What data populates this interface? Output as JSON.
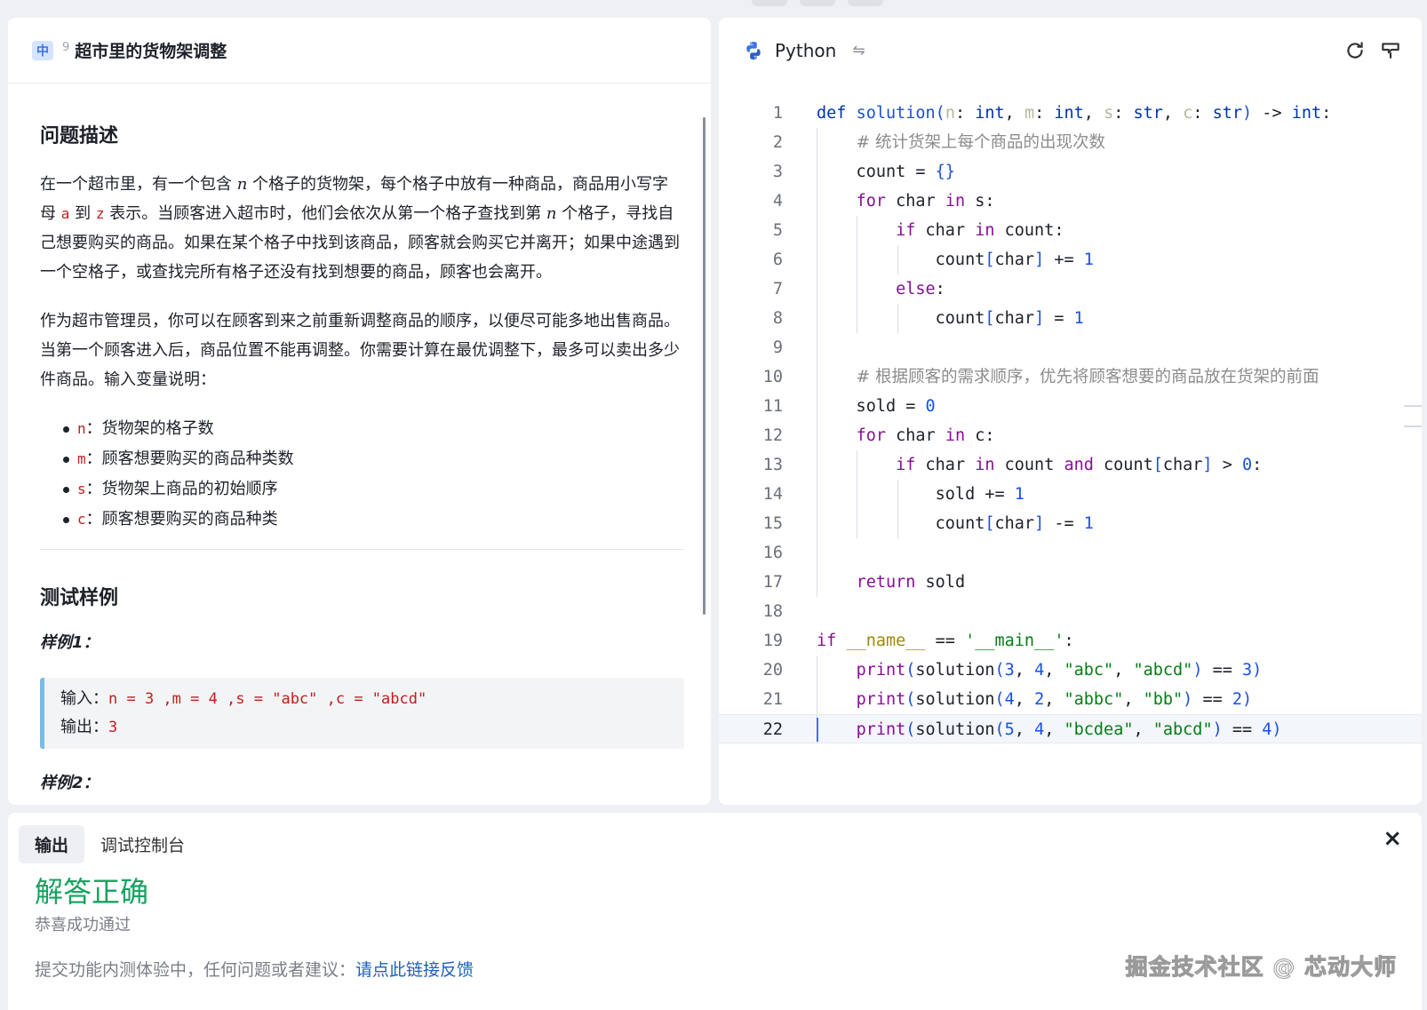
{
  "problem": {
    "difficulty": "中",
    "number": "9",
    "title": "超市里的货物架调整",
    "description_heading": "问题描述",
    "p1": [
      {
        "t": "text",
        "v": "在一个超市里，有一个包含 "
      },
      {
        "t": "var",
        "v": "n"
      },
      {
        "t": "text",
        "v": " 个格子的货物架，每个格子中放有一种商品，商品用小写字母 "
      },
      {
        "t": "code",
        "v": "a"
      },
      {
        "t": "text",
        "v": " 到 "
      },
      {
        "t": "code",
        "v": "z"
      },
      {
        "t": "text",
        "v": " 表示。当顾客进入超市时，他们会依次从第一个格子查找到第 "
      },
      {
        "t": "var",
        "v": "n"
      },
      {
        "t": "text",
        "v": " 个格子，寻找自己想要购买的商品。如果在某个格子中找到该商品，顾客就会购买它并离开；如果中途遇到一个空格子，或查找完所有格子还没有找到想要的商品，顾客也会离开。"
      }
    ],
    "p2": "作为超市管理员，你可以在顾客到来之前重新调整商品的顺序，以便尽可能多地出售商品。当第一个顾客进入后，商品位置不能再调整。你需要计算在最优调整下，最多可以卖出多少件商品。输入变量说明：",
    "vars": [
      {
        "name": "n",
        "desc": "：货物架的格子数"
      },
      {
        "name": "m",
        "desc": "：顾客想要购买的商品种类数"
      },
      {
        "name": "s",
        "desc": "：货物架上商品的初始顺序"
      },
      {
        "name": "c",
        "desc": "：顾客想要购买的商品种类"
      }
    ],
    "samples_heading": "测试样例",
    "sample1_title": "样例1：",
    "sample1_input_label": "输入：",
    "sample1_input": "n = 3 ,m = 4 ,s = \"abc\" ,c = \"abcd\"",
    "sample1_output_label": "输出：",
    "sample1_output": "3",
    "sample2_title": "样例2："
  },
  "editor": {
    "language": "Python",
    "icons": [
      "python-logo-icon",
      "switch-icon",
      "refresh-icon",
      "format-icon"
    ],
    "code": [
      "def solution(n: int, m: int, s: str, c: str) -> int:",
      "    # 统计货架上每个商品的出现次数",
      "    count = {}",
      "    for char in s:",
      "        if char in count:",
      "            count[char] += 1",
      "        else:",
      "            count[char] = 1",
      "",
      "    # 根据顾客的需求顺序，优先将顾客想要的商品放在货架的前面",
      "    sold = 0",
      "    for char in c:",
      "        if char in count and count[char] > 0:",
      "            sold += 1",
      "            count[char] -= 1",
      "",
      "    return sold",
      "",
      "if __name__ == '__main__':",
      "    print(solution(3, 4, \"abc\", \"abcd\") == 3)",
      "    print(solution(4, 2, \"abbc\", \"bb\") == 2)",
      "    print(solution(5, 4, \"bcdea\", \"abcd\") == 4)"
    ],
    "active_line": 22
  },
  "console": {
    "tabs": [
      "输出",
      "调试控制台"
    ],
    "active_tab": "输出",
    "result": "解答正确",
    "result_sub": "恭喜成功通过",
    "feedback_prefix": "提交功能内测体验中，任何问题或者建议：",
    "feedback_link": "请点此链接反馈",
    "close_icon": "close-icon"
  },
  "watermark": "掘金技术社区 @ 芯动大师",
  "colors": {
    "accent": "#3a74e8",
    "success": "#14a35f",
    "link": "#1d62b8",
    "code_red": "#c41d1d"
  }
}
